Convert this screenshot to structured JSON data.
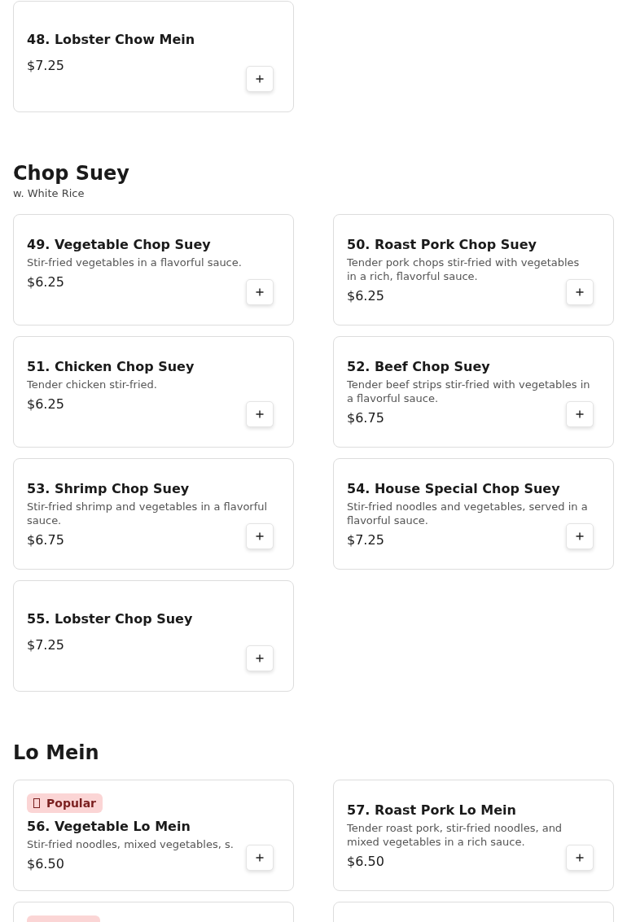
{
  "sections": [
    {
      "items": [
        {
          "name": "48. Lobster Chow Mein",
          "price": "$7.25"
        }
      ]
    },
    {
      "title": "Chop Suey",
      "subtitle": "w. White Rice",
      "items": [
        {
          "name": "49. Vegetable Chop Suey",
          "description": "Stir-fried vegetables in a flavorful sauce.",
          "price": "$6.25"
        },
        {
          "name": "50. Roast Pork Chop Suey",
          "description": "Tender pork chops stir-fried with vegetables in a rich, flavorful sauce.",
          "price": "$6.25"
        },
        {
          "name": "51. Chicken Chop Suey",
          "description": "Tender chicken stir-fried.",
          "price": "$6.25"
        },
        {
          "name": "52. Beef Chop Suey",
          "description": "Tender beef strips stir-fried with vegetables in a flavorful sauce.",
          "price": "$6.75"
        },
        {
          "name": "53. Shrimp Chop Suey",
          "description": "Stir-fried shrimp and vegetables in a flavorful sauce.",
          "price": "$6.75"
        },
        {
          "name": "54. House Special Chop Suey",
          "description": "Stir-fried noodles and vegetables, served in a flavorful sauce.",
          "price": "$7.25"
        },
        {
          "name": "55. Lobster Chop Suey",
          "price": "$7.25"
        }
      ]
    },
    {
      "title": "Lo Mein",
      "items": [
        {
          "badge": "Popular",
          "name": "56. Vegetable Lo Mein",
          "description": "Stir-fried noodles, mixed vegetables, s.",
          "price": "$6.50"
        },
        {
          "name": "57. Roast Pork Lo Mein",
          "description": "Tender roast pork, stir-fried noodles, and mixed vegetables in a rich sauce.",
          "price": "$6.50"
        },
        {
          "badge_shape": true
        },
        {
          "badge_shape": false
        }
      ]
    }
  ]
}
